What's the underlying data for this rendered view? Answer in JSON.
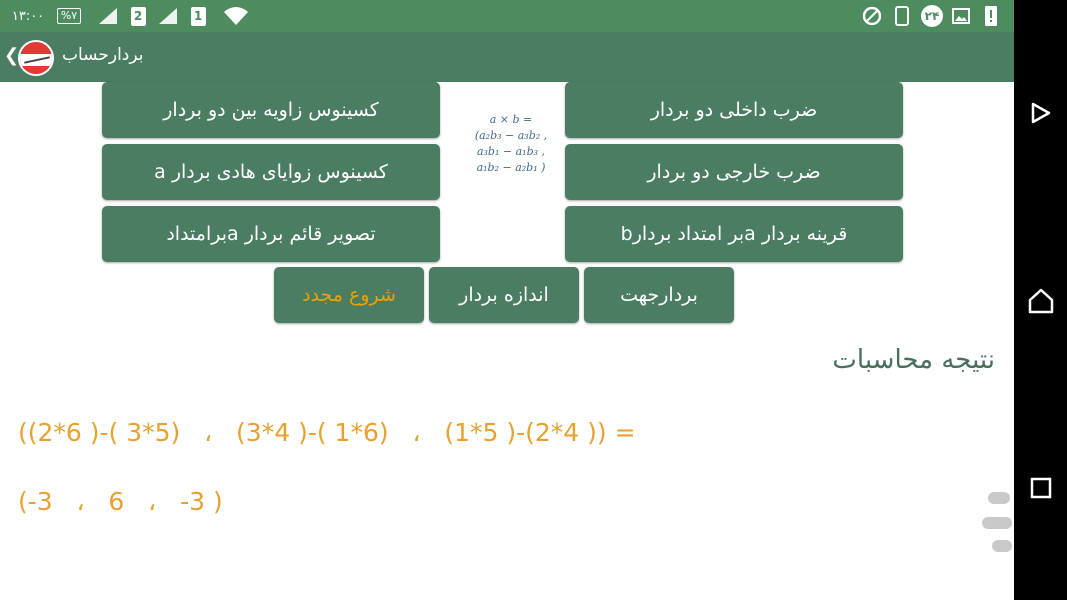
{
  "status_bar": {
    "time": "۱۳:۰۰",
    "battery": "%۷",
    "sim1": "2",
    "sim2": "1",
    "notif_count": "۲۴"
  },
  "app_bar": {
    "title": "بردارحساب",
    "back": "❮"
  },
  "buttons": {
    "cos_angle_between": "کسینوس زاویه بین دو بردار",
    "dot_product": "ضرب داخلی دو بردار",
    "cos_direction_angles": "کسینوس زوایای هادی بردار a",
    "cross_product": "ضرب خارجی دو بردار",
    "orthogonal_projection": "تصویر قائم بردار aبرامتداد",
    "reflection": "قرینه بردار aبر امتداد بردارb",
    "restart": "شروع مجدد",
    "magnitude": "اندازه بردار",
    "direction_vector": "بردارجهت"
  },
  "formula": {
    "line1": "a × b =",
    "line2": "(a₂b₃ − a₃b₂ ,",
    "line3": "a₃b₁ − a₁b₃ ,",
    "line4": "a₁b₂ − a₂b₁ )"
  },
  "result": {
    "title": "نتیجه محاسبات",
    "expression": "((2*6 )-( 3*5)   ،   (3*4 )-( 1*6)   ،   (1*5 )-(2*4 )) =",
    "value": "(-3   ،   6   ،   -3 )"
  },
  "colors": {
    "status_bar": "#4d8c5f",
    "app_bar": "#4a7d62",
    "button": "#4a7d62",
    "result_text": "#e8a030",
    "accent_text": "#f0a000"
  }
}
